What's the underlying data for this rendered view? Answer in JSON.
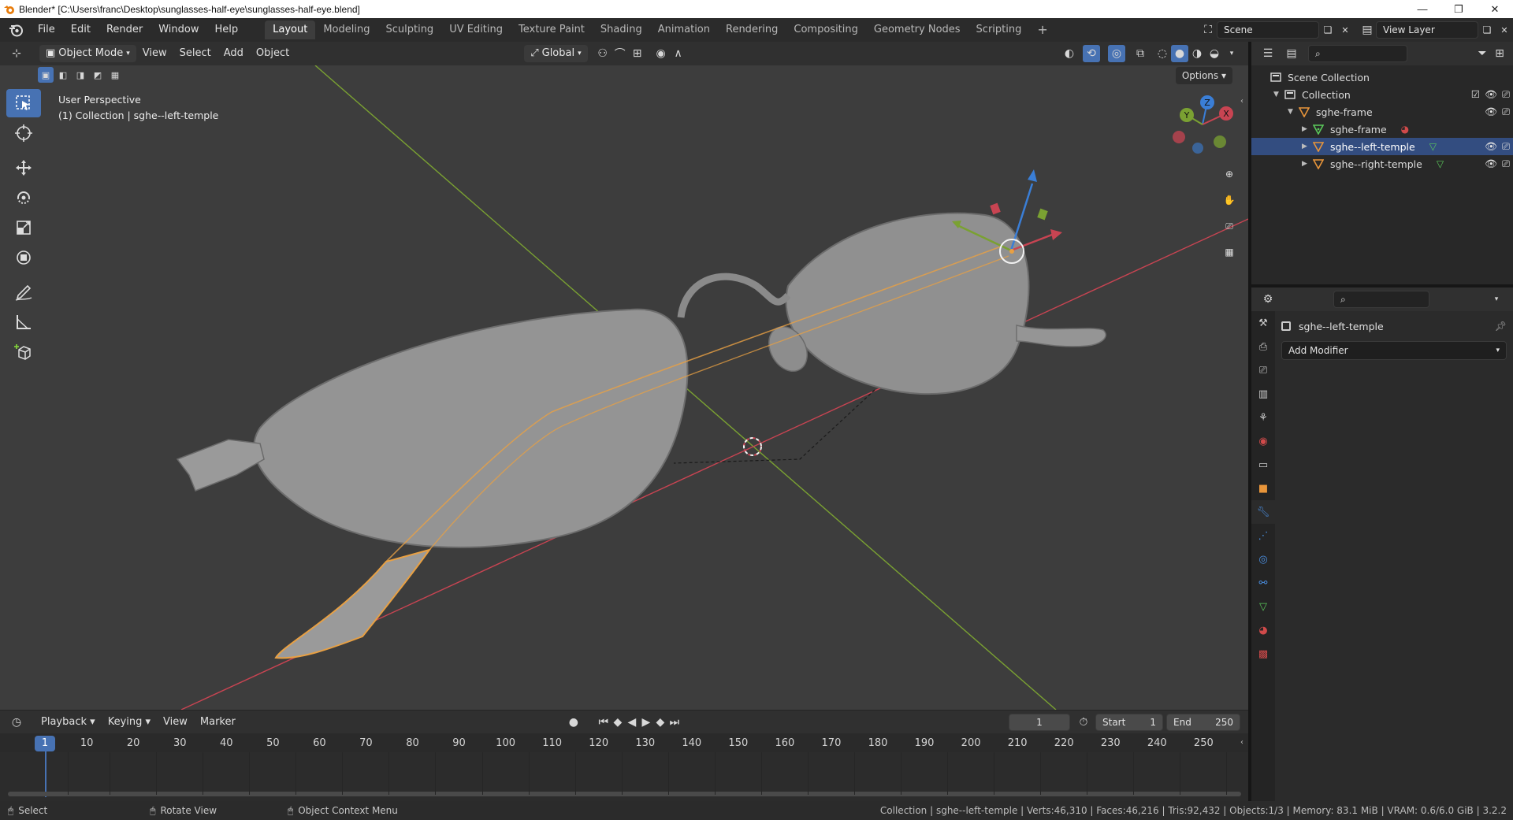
{
  "window": {
    "title": "Blender* [C:\\Users\\franc\\Desktop\\sunglasses-half-eye\\sunglasses-half-eye.blend]",
    "minimize": "—",
    "restore": "❐",
    "close": "✕"
  },
  "menu": [
    "File",
    "Edit",
    "Render",
    "Window",
    "Help"
  ],
  "workspaces": [
    "Layout",
    "Modeling",
    "Sculpting",
    "UV Editing",
    "Texture Paint",
    "Shading",
    "Animation",
    "Rendering",
    "Compositing",
    "Geometry Nodes",
    "Scripting"
  ],
  "active_workspace": "Layout",
  "add_workspace": "+",
  "scene": {
    "name": "Scene",
    "view_layer": "View Layer"
  },
  "viewport_header": {
    "mode": "Object Mode",
    "menus": [
      "View",
      "Select",
      "Add",
      "Object"
    ],
    "orientation": "Global",
    "options": "Options"
  },
  "viewport": {
    "perspective": "User Perspective",
    "collection_info": "(1) Collection | sghe--left-temple",
    "gizmo_axes": {
      "x": "X",
      "y": "Y",
      "z": "Z"
    }
  },
  "tools": [
    "select-box",
    "cursor",
    "move",
    "rotate",
    "scale",
    "transform",
    "annotate",
    "measure",
    "add-cube"
  ],
  "outliner": {
    "rows": [
      {
        "label": "Scene Collection",
        "indent": 0,
        "icon": "scene-collection-icon"
      },
      {
        "label": "Collection",
        "indent": 1,
        "icon": "collection-icon"
      },
      {
        "label": "sghe-frame",
        "indent": 2,
        "icon": "object-icon"
      },
      {
        "label": "sghe-frame",
        "indent": 3,
        "icon": "mesh-icon"
      },
      {
        "label": "sghe--left-temple",
        "indent": 3,
        "icon": "object-icon",
        "selected": true
      },
      {
        "label": "sghe--right-temple",
        "indent": 3,
        "icon": "object-icon"
      }
    ]
  },
  "properties": {
    "object_name": "sghe--left-temple",
    "add_modifier": "Add Modifier"
  },
  "timeline_header": {
    "menus": [
      "Playback",
      "Keying",
      "View",
      "Marker"
    ],
    "current_frame": "1",
    "start_label": "Start",
    "start": "1",
    "end_label": "End",
    "end": "250"
  },
  "timeline": {
    "ticks": [
      "1",
      "10",
      "20",
      "30",
      "40",
      "50",
      "60",
      "70",
      "80",
      "90",
      "100",
      "110",
      "120",
      "130",
      "140",
      "150",
      "160",
      "170",
      "180",
      "190",
      "200",
      "210",
      "220",
      "230",
      "240",
      "250"
    ]
  },
  "statusbar": {
    "select": "Select",
    "rotate": "Rotate View",
    "context": "Object Context Menu",
    "stats": "Collection | sghe--left-temple | Verts:46,310 | Faces:46,216 | Tris:92,432 | Objects:1/3 | Memory: 83.1 MiB | VRAM: 0.6/6.0 GiB | 3.2.2"
  },
  "colors": {
    "accent": "#4772b3",
    "selection_outline": "#e8a043",
    "x_axis": "#c84452",
    "y_axis": "#7aa132",
    "z_axis": "#3a7ed6"
  }
}
